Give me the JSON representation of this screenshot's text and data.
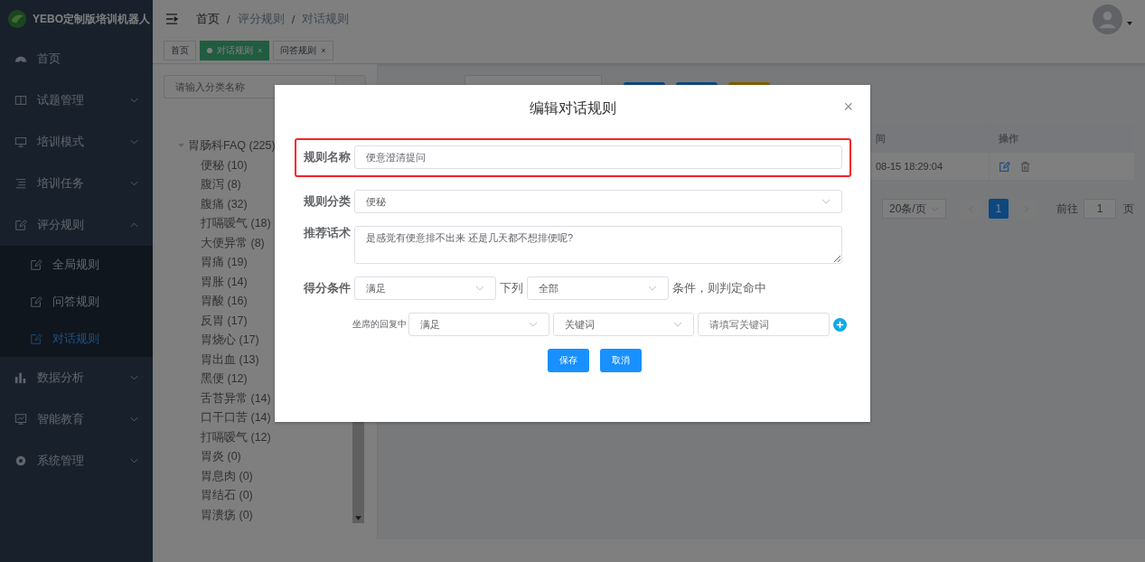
{
  "app": {
    "title": "YEBO定制版培训机器人"
  },
  "sidebar": {
    "items": [
      {
        "label": "首页"
      },
      {
        "label": "试题管理",
        "expanded": false
      },
      {
        "label": "培训模式",
        "expanded": false
      },
      {
        "label": "培训任务",
        "expanded": false
      },
      {
        "label": "评分规则",
        "expanded": true,
        "children": [
          {
            "label": "全局规则",
            "selected": false
          },
          {
            "label": "问答规则",
            "selected": false
          },
          {
            "label": "对话规则",
            "selected": true
          }
        ]
      },
      {
        "label": "数据分析",
        "expanded": false
      },
      {
        "label": "智能教育",
        "expanded": false
      },
      {
        "label": "系统管理",
        "expanded": false
      }
    ]
  },
  "breadcrumb": [
    {
      "label": "首页"
    },
    {
      "separator": "/",
      "label": "评分规则"
    },
    {
      "separator": "/",
      "label": "对话规则"
    }
  ],
  "tags": [
    {
      "label": "首页",
      "selected": false,
      "closable": false
    },
    {
      "label": "对话规则",
      "selected": true,
      "closable": true,
      "close": "×"
    },
    {
      "label": "问答规则",
      "selected": false,
      "closable": true,
      "close": "×"
    }
  ],
  "tree": {
    "placeholder": "请输入分类名称",
    "root": {
      "label": "胃肠科FAQ (225)",
      "expanded": true,
      "children": [
        {
          "label": "便秘 (10)"
        },
        {
          "label": "腹泻 (8)"
        },
        {
          "label": "腹痛 (32)"
        },
        {
          "label": "打嗝嗳气 (18)"
        },
        {
          "label": "大便异常 (8)"
        },
        {
          "label": "胃痛 (19)"
        },
        {
          "label": "胃胀 (14)"
        },
        {
          "label": "胃酸 (16)"
        },
        {
          "label": "反胃 (17)"
        },
        {
          "label": "胃烧心 (17)"
        },
        {
          "label": "胃出血 (13)"
        },
        {
          "label": "黑便 (12)"
        },
        {
          "label": "舌苔异常 (14)"
        },
        {
          "label": "口干口苦 (14)"
        },
        {
          "label": "打嗝嗳气 (12)"
        },
        {
          "label": "胃炎 (0)"
        },
        {
          "label": "胃息肉 (0)"
        },
        {
          "label": "胃结石 (0)"
        },
        {
          "label": "胃溃疡 (0)"
        }
      ]
    }
  },
  "table": {
    "columns": [
      "间",
      "操作"
    ],
    "rows": [
      {
        "time": "08-15 18:29:04"
      }
    ]
  },
  "pagination": {
    "page_size": "20条/页",
    "pages": [
      {
        "label": "1",
        "selected": true
      }
    ],
    "goto_label": "前往",
    "goto_value": "1",
    "page_suffix": "页"
  },
  "modal": {
    "title": "编辑对话规则",
    "close": "×",
    "name": {
      "label": "规则名称",
      "value": "便意澄清提问",
      "highlighted": true
    },
    "category": {
      "label": "规则分类",
      "value": "便秘"
    },
    "script": {
      "label": "推荐话术",
      "value": "是感觉有便意排不出来 还是几天都不想排便呢?"
    },
    "condition": {
      "label": "得分条件",
      "match": "满足",
      "middle": "下列",
      "scope": "全部",
      "suffix": "条件，则判定命中"
    },
    "rule": {
      "label": "坐席的回复中",
      "match": "满足",
      "type": "关键词",
      "placeholder": "请填写关键词"
    },
    "buttons": [
      "保存",
      "取消"
    ]
  }
}
